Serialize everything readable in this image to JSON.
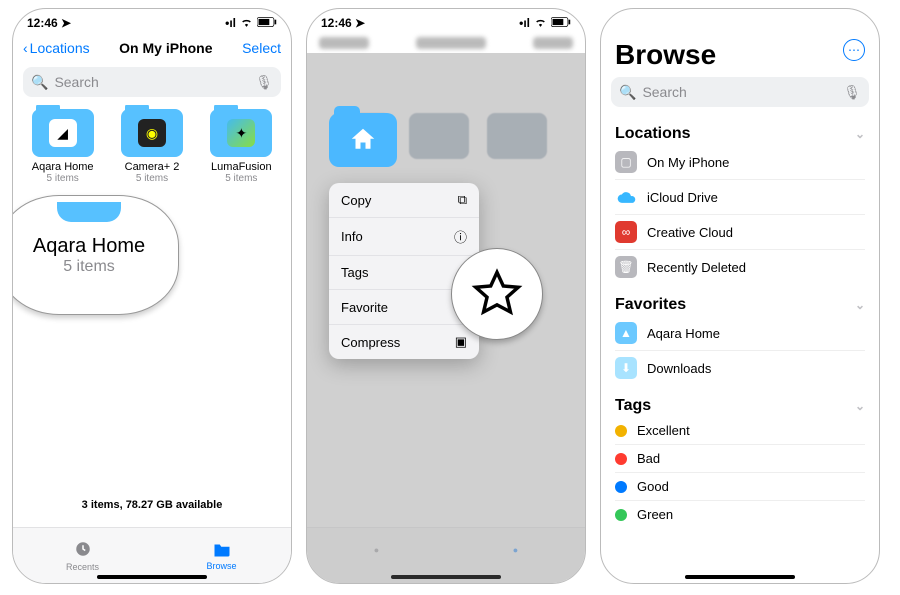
{
  "status": {
    "time": "12:46",
    "loc_arrow": "➤",
    "signal": "••ıl",
    "wifi": "wifi",
    "battery": "batt"
  },
  "panel1": {
    "back_label": "Locations",
    "title": "On My iPhone",
    "select_label": "Select",
    "search_placeholder": "Search",
    "folders": [
      {
        "name": "Aqara Home",
        "sub": "5 items"
      },
      {
        "name": "Camera+ 2",
        "sub": "5 items"
      },
      {
        "name": "LumaFusion",
        "sub": "5 items"
      }
    ],
    "callout": {
      "title": "Aqara Home",
      "sub": "5 items"
    },
    "footer": "3 items, 78.27 GB available",
    "tabs": {
      "recents": "Recents",
      "browse": "Browse"
    }
  },
  "panel2": {
    "menu": [
      {
        "label": "Copy",
        "icon": "copy"
      },
      {
        "label": "Info",
        "icon": "info"
      },
      {
        "label": "Tags",
        "icon": "tags"
      },
      {
        "label": "Favorite",
        "icon": "star"
      },
      {
        "label": "Compress",
        "icon": "compress"
      }
    ]
  },
  "panel3": {
    "title": "Browse",
    "search_placeholder": "Search",
    "sections": {
      "locations": {
        "header": "Locations",
        "items": [
          {
            "label": "On My iPhone",
            "icon": "phone"
          },
          {
            "label": "iCloud Drive",
            "icon": "cloud"
          },
          {
            "label": "Creative Cloud",
            "icon": "cc"
          },
          {
            "label": "Recently Deleted",
            "icon": "trash"
          }
        ]
      },
      "favorites": {
        "header": "Favorites",
        "items": [
          {
            "label": "Aqara Home"
          },
          {
            "label": "Downloads"
          }
        ]
      },
      "tags": {
        "header": "Tags",
        "items": [
          {
            "label": "Excellent",
            "color": "#f2b200"
          },
          {
            "label": "Bad",
            "color": "#ff3b30"
          },
          {
            "label": "Good",
            "color": "#007aff"
          },
          {
            "label": "Green",
            "color": "#34c759"
          }
        ]
      }
    }
  }
}
